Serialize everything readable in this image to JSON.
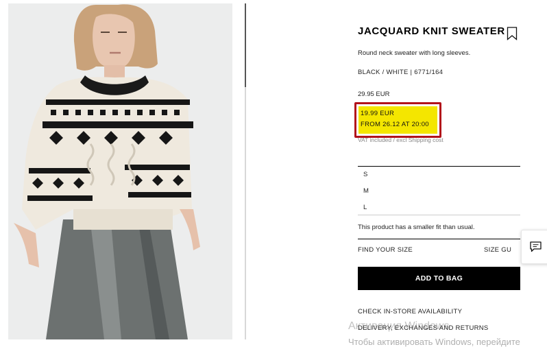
{
  "product": {
    "title": "JACQUARD KNIT SWEATER",
    "description": "Round neck sweater with long sleeves.",
    "color_ref": "BLACK / WHITE | 6771/164",
    "price": "29.95 EUR",
    "promo_price": "19.99 EUR",
    "promo_from": "FROM 26.12 AT 20:00",
    "vat_note": "VAT included / excl Shipping cost"
  },
  "sizes": [
    "S",
    "M",
    "L"
  ],
  "fit_note": "This product has a smaller fit than usual.",
  "links": {
    "find_size": "FIND YOUR SIZE",
    "size_guide": "SIZE GUIDE",
    "check_store": "CHECK IN-STORE AVAILABILITY",
    "delivery": "DELIVERY, EXCHANGES AND RETURNS"
  },
  "add_to_bag_label": "ADD TO BAG",
  "icons": {
    "bookmark": "bookmark-icon",
    "chat": "chat-icon"
  },
  "colors": {
    "promo_highlight": "#f4e600",
    "promo_border": "#b2121a",
    "button_bg": "#000000"
  },
  "watermark": {
    "line1": "Активация Windows",
    "line2": "Чтобы активировать Windows, перейдите"
  }
}
